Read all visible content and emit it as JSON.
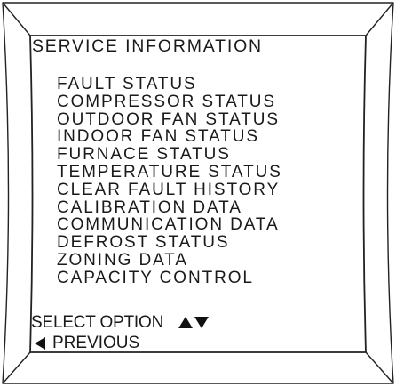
{
  "screen": {
    "title": "SERVICE INFORMATION",
    "menu_items": [
      {
        "label": "FAULT STATUS"
      },
      {
        "label": "COMPRESSOR STATUS"
      },
      {
        "label": "OUTDOOR FAN STATUS"
      },
      {
        "label": "INDOOR FAN STATUS"
      },
      {
        "label": "FURNACE STATUS"
      },
      {
        "label": "TEMPERATURE STATUS"
      },
      {
        "label": "CLEAR FAULT HISTORY"
      },
      {
        "label": "CALIBRATION DATA"
      },
      {
        "label": "COMMUNICATION DATA"
      },
      {
        "label": "DEFROST STATUS"
      },
      {
        "label": "ZONING DATA"
      },
      {
        "label": "CAPACITY CONTROL"
      }
    ],
    "footer": {
      "select_label": "SELECT OPTION",
      "previous_label": "PREVIOUS"
    }
  },
  "icons": {
    "up_arrow": "triangle-up-icon",
    "down_arrow": "triangle-down-icon",
    "left_arrow": "triangle-left-icon"
  },
  "colors": {
    "ink": "#111111",
    "background": "#ffffff"
  }
}
